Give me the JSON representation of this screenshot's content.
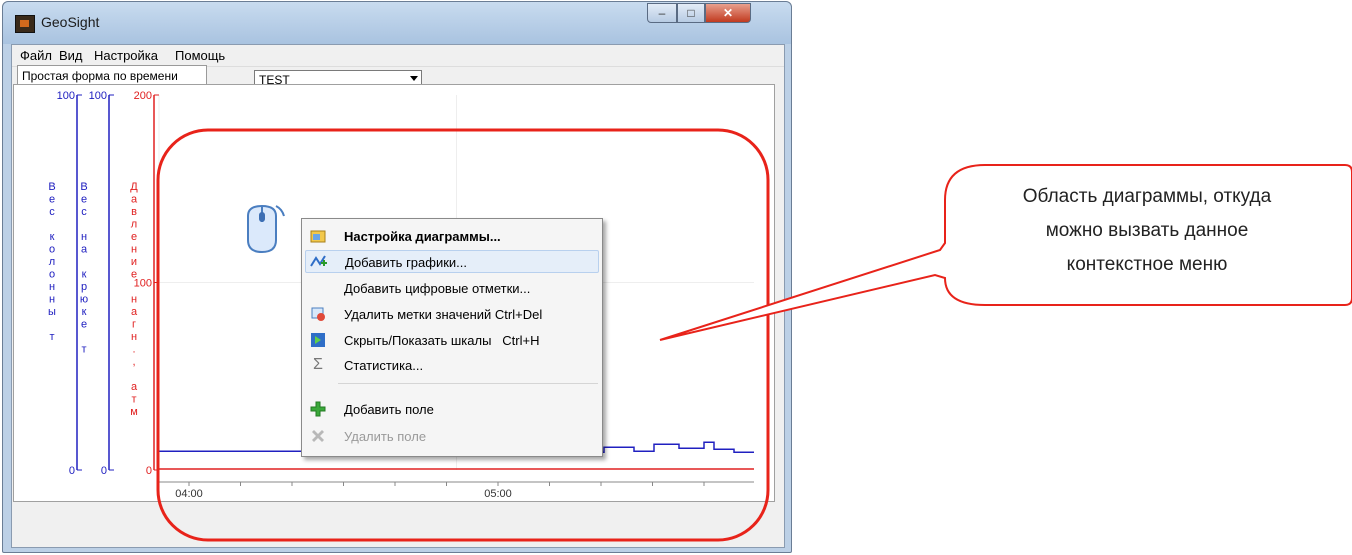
{
  "window": {
    "title": "GeoSight",
    "controls": {
      "minimize": "–",
      "maximize": "□",
      "close": "✕"
    }
  },
  "menu": [
    "Файл",
    "Вид",
    "Настройка",
    "Помощь"
  ],
  "toolbar": {
    "icons": [
      "new-document-icon",
      "oil-rig-icon",
      "open-folder-icon",
      "save-icon",
      "save-all-icon",
      "copy-icon",
      "paste-icon"
    ],
    "profile_select": "TEST"
  },
  "tab": {
    "label": "Простая форма по времени"
  },
  "chart_data": {
    "type": "line",
    "axes": [
      {
        "label": "Вес колонны т",
        "min": 0,
        "max": 100,
        "color": "#2020c0",
        "ticks": [
          "100",
          "0"
        ]
      },
      {
        "label": "Вес на крюке т",
        "min": 0,
        "max": 100,
        "color": "#2020c0",
        "ticks": [
          "100",
          "0"
        ]
      },
      {
        "label": "Давление нагн., атм",
        "min": 0,
        "max": 200,
        "color": "#e02020",
        "ticks": [
          "200",
          "100",
          "0"
        ]
      }
    ],
    "x_ticks": [
      "04:00",
      "05:00"
    ],
    "series": [
      {
        "color": "#2020c0",
        "x": [
          "04:00",
          "05:00",
          "05:45"
        ],
        "y": [
          5,
          5,
          6
        ]
      },
      {
        "color": "#e02020",
        "x": [
          "04:00",
          "05:45"
        ],
        "y": [
          0,
          0
        ]
      }
    ],
    "grid": true
  },
  "context_menu": {
    "items": [
      {
        "icon": "chart-settings-icon",
        "label": "Настройка диаграммы...",
        "bold": true
      },
      {
        "icon": "add-graphs-icon",
        "label": "Добавить графики...",
        "hover": true
      },
      {
        "icon": "",
        "label": "Добавить цифровые отметки..."
      },
      {
        "icon": "delete-marks-icon",
        "label": "Удалить метки значений",
        "shortcut": "Ctrl+Del"
      },
      {
        "icon": "toggle-scales-icon",
        "label": "Скрыть/Показать шкалы",
        "shortcut": "Ctrl+H"
      },
      {
        "icon": "sigma-icon",
        "label": "Статистика..."
      },
      {
        "icon": "add-field-icon",
        "label": "Добавить поле"
      },
      {
        "icon": "delete-field-icon",
        "label": "Удалить поле",
        "disabled": true
      }
    ]
  },
  "callout": {
    "text": "Область диаграммы, откуда можно вызвать данное контекстное меню",
    "lines": [
      "Область диаграммы, откуда",
      "можно вызвать данное",
      "контекстное меню"
    ]
  },
  "colors": {
    "highlight_outline": "#e8231a",
    "axis_blue": "#2020c0",
    "axis_red": "#e02020"
  }
}
